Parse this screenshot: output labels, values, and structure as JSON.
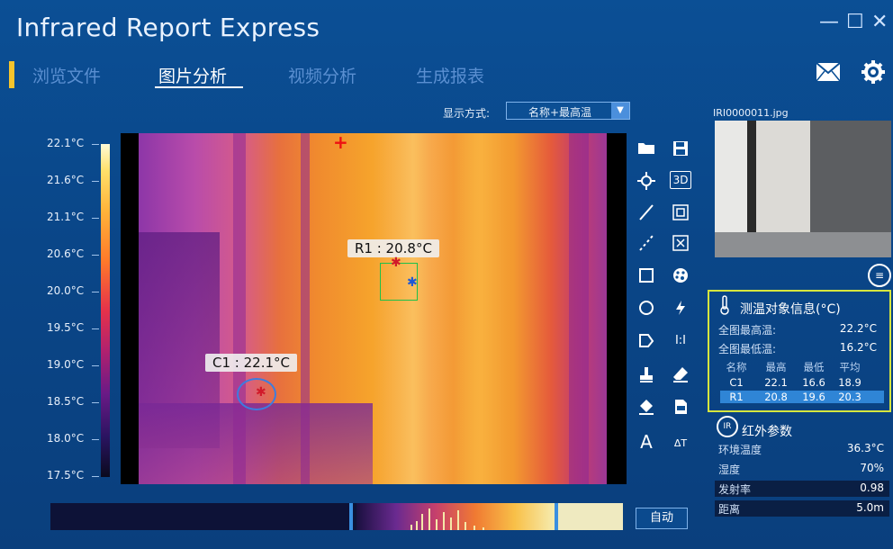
{
  "app": {
    "title": "Infrared Report Express"
  },
  "window_controls": {
    "minimize": "—",
    "maximize": "☐",
    "close": "✕"
  },
  "tabs": [
    {
      "label": "浏览文件",
      "active": false
    },
    {
      "label": "图片分析",
      "active": true
    },
    {
      "label": "视频分析",
      "active": false
    },
    {
      "label": "生成报表",
      "active": false
    }
  ],
  "header_icons": {
    "mail": "mail-icon",
    "settings": "gear-icon"
  },
  "display_mode": {
    "label": "显示方式:",
    "value": "名称+最高温"
  },
  "scale": {
    "ticks": [
      "22.1°C",
      "21.6°C",
      "21.1°C",
      "20.6°C",
      "20.0°C",
      "19.5°C",
      "19.0°C",
      "18.5°C",
      "18.0°C",
      "17.5°C"
    ]
  },
  "markers": {
    "r1": "R1 : 20.8°C",
    "c1": "C1 : 22.1°C"
  },
  "tools": {
    "open": "folder-icon",
    "save": "save-icon",
    "spot": "crosshair-icon",
    "three_d": "3D",
    "line": "line-icon",
    "copy": "copy-icon",
    "dashed_line": "dashed-line-icon",
    "delete": "delete-icon",
    "rect": "rectangle-icon",
    "palette": "palette-icon",
    "circle": "circle-icon",
    "flash": "flash-icon",
    "polygon": "polygon-icon",
    "ratio": "I:I",
    "stamp": "stamp-icon",
    "eraser": "eraser-icon",
    "fill": "fill-icon",
    "export": "export-icon",
    "text": "A",
    "text_size": "ΔT"
  },
  "histogram": {
    "auto_button": "自动"
  },
  "file": {
    "name": "IRI0000011.jpg"
  },
  "measure_panel": {
    "title": "测温对象信息(°C)",
    "max_label": "全图最高温:",
    "max_value": "22.2°C",
    "min_label": "全图最低温:",
    "min_value": "16.2°C",
    "table": {
      "headers": [
        "名称",
        "最高",
        "最低",
        "平均"
      ],
      "rows": [
        [
          "C1",
          "22.1",
          "16.6",
          "18.9"
        ],
        [
          "R1",
          "20.8",
          "19.6",
          "20.3"
        ]
      ],
      "selected_row": 1
    }
  },
  "ir_params": {
    "badge": "IR",
    "title": "红外参数",
    "rows": [
      {
        "label": "环境温度",
        "value": "36.3°C"
      },
      {
        "label": "湿度",
        "value": "70%"
      },
      {
        "label": "发射率",
        "value": "0.98"
      },
      {
        "label": "距离",
        "value": "5.0m"
      }
    ]
  },
  "colors": {
    "accent": "#f6c42c",
    "panel_border": "#d6e63e",
    "background": "#0b4f95",
    "selected_row": "#2f85d6"
  }
}
